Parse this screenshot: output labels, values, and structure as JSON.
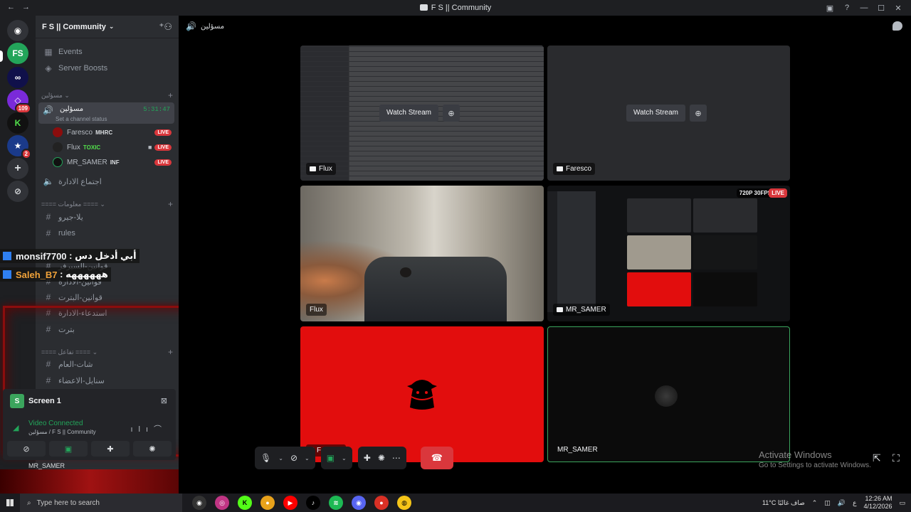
{
  "window": {
    "title": "F S || Community"
  },
  "server": {
    "name": "F S || Community"
  },
  "rail": {
    "badges": [
      "109",
      "2"
    ]
  },
  "sidebar": {
    "nav": [
      {
        "icon": "calendar-icon",
        "label": "Events"
      },
      {
        "icon": "boost-icon",
        "label": "Server Boosts"
      }
    ],
    "category1": "مسؤلين",
    "active_voice": {
      "name": "مسؤلين",
      "status": "Set a channel status",
      "timer": "5:31:47"
    },
    "members": [
      {
        "name": "Faresco",
        "tag": "MHRC",
        "live": "LIVE"
      },
      {
        "name": "Flux",
        "tag": "TOXIC",
        "live": "LIVE"
      },
      {
        "name": "MR_SAMER",
        "tag": "INF",
        "live": "LIVE"
      }
    ],
    "voice2": "اجتماع الادارة",
    "category2": "==== معلومات ====",
    "text_channels": [
      "يلا-جيرو",
      "rules",
      "قوانين-السيرفر",
      "قوانين-الادارة",
      "قوانين-البترت",
      "استدعاء-الادارة",
      "بترت"
    ],
    "category3": "==== تفاعل ====",
    "text_channels2": [
      "شات-العام",
      "سنايل-الاعضاء"
    ]
  },
  "overlay_chat": [
    {
      "user": "monsif7700",
      "text": ": أبي أدخل دس"
    },
    {
      "user": "Saleh_B7",
      "text": ": ههههههه"
    }
  ],
  "panel": {
    "screen_label": "Screen 1",
    "status": "Video Connected",
    "channel": "مسؤلين / F S || Community",
    "user_name": "MR_SAMER"
  },
  "main": {
    "channel": "مسؤلين",
    "watch_label": "Watch Stream",
    "tiles": [
      {
        "name": "Flux"
      },
      {
        "name": "Faresco"
      },
      {
        "name": "Flux"
      },
      {
        "name": "MR_SAMER",
        "quality": "720P 30FPS",
        "live": "LIVE"
      },
      {
        "name": "Faresco"
      },
      {
        "name": "MR_SAMER"
      }
    ]
  },
  "watermark": {
    "line1": "Activate Windows",
    "line2": "Go to Settings to activate Windows."
  },
  "taskbar": {
    "search_placeholder": "Type here to search",
    "weather": "11°C  صاف غالبًا",
    "lang": "ع",
    "time": "12:26 AM",
    "date": "4/12/2026"
  },
  "colors": {
    "accent_green": "#23a55a",
    "live_red": "#da373c",
    "stream_red": "#e20d0d"
  }
}
